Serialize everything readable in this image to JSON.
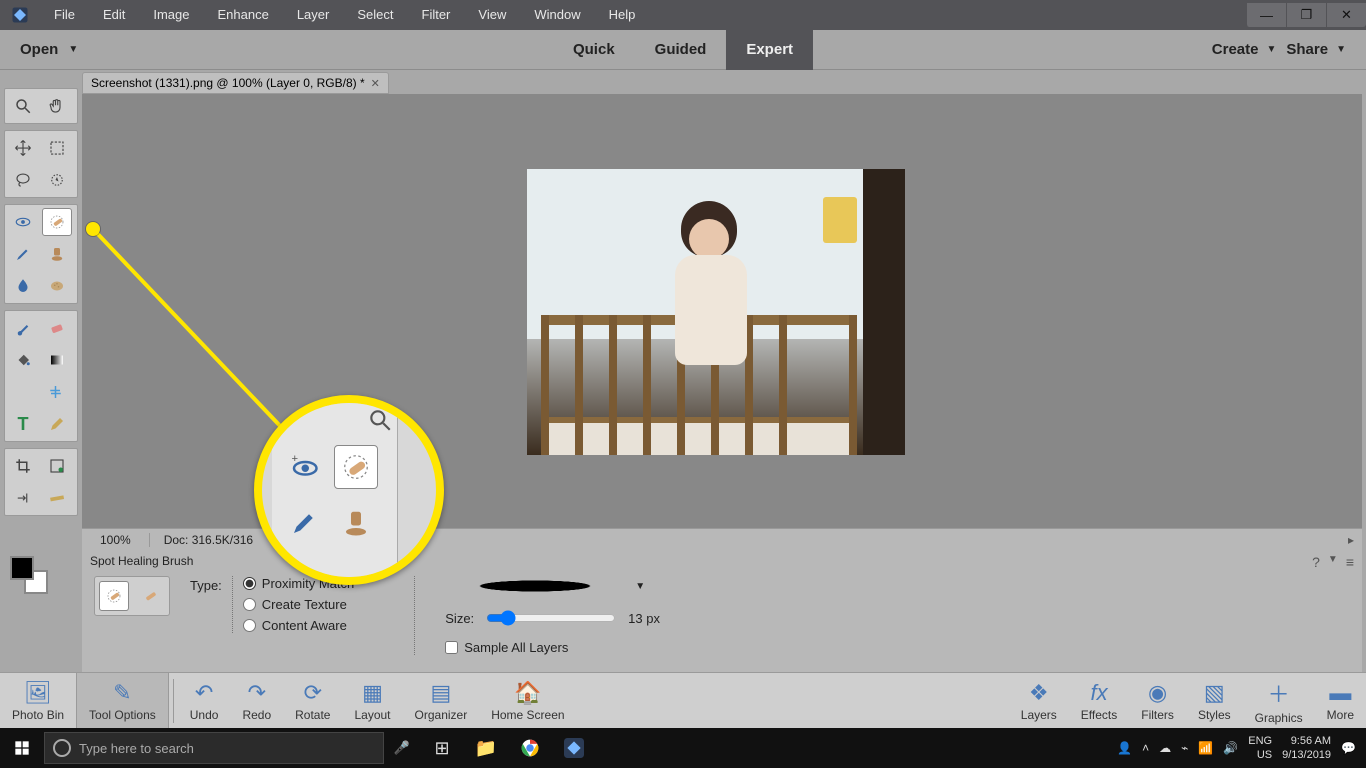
{
  "menu": {
    "items": [
      "File",
      "Edit",
      "Image",
      "Enhance",
      "Layer",
      "Select",
      "Filter",
      "View",
      "Window",
      "Help"
    ]
  },
  "secbar": {
    "open": "Open",
    "modes": [
      "Quick",
      "Guided",
      "Expert"
    ],
    "active_mode": "Expert",
    "create": "Create",
    "share": "Share"
  },
  "doc_tab": {
    "label": "Screenshot (1331).png @ 100% (Layer 0, RGB/8) *"
  },
  "meta": {
    "zoom": "100%",
    "doc": "Doc: 316.5K/316"
  },
  "tool_options": {
    "title": "Spot Healing Brush",
    "type_label": "Type:",
    "types": [
      {
        "label": "Proximity Match",
        "checked": true
      },
      {
        "label": "Create Texture",
        "checked": false
      },
      {
        "label": "Content Aware",
        "checked": false
      }
    ],
    "size_label": "Size:",
    "size_value": "13 px",
    "sample_all": "Sample All Layers"
  },
  "bottom_bar": {
    "left": [
      {
        "label": "Photo Bin",
        "icon": "image-icon"
      },
      {
        "label": "Tool Options",
        "icon": "pencil-panel-icon",
        "selected": true
      },
      {
        "label": "Undo",
        "icon": "undo-icon"
      },
      {
        "label": "Redo",
        "icon": "redo-icon"
      },
      {
        "label": "Rotate",
        "icon": "rotate-icon"
      },
      {
        "label": "Layout",
        "icon": "layout-icon"
      },
      {
        "label": "Organizer",
        "icon": "grid-icon"
      },
      {
        "label": "Home Screen",
        "icon": "home-icon"
      }
    ],
    "right": [
      {
        "label": "Layers",
        "icon": "layers-icon"
      },
      {
        "label": "Effects",
        "icon": "fx-icon"
      },
      {
        "label": "Filters",
        "icon": "filters-icon"
      },
      {
        "label": "Styles",
        "icon": "styles-icon"
      },
      {
        "label": "Graphics",
        "icon": "plus-icon"
      },
      {
        "label": "More",
        "icon": "more-icon"
      }
    ]
  },
  "taskbar": {
    "search_placeholder": "Type here to search",
    "lang1": "ENG",
    "lang2": "US",
    "time": "9:56 AM",
    "date": "9/13/2019"
  }
}
